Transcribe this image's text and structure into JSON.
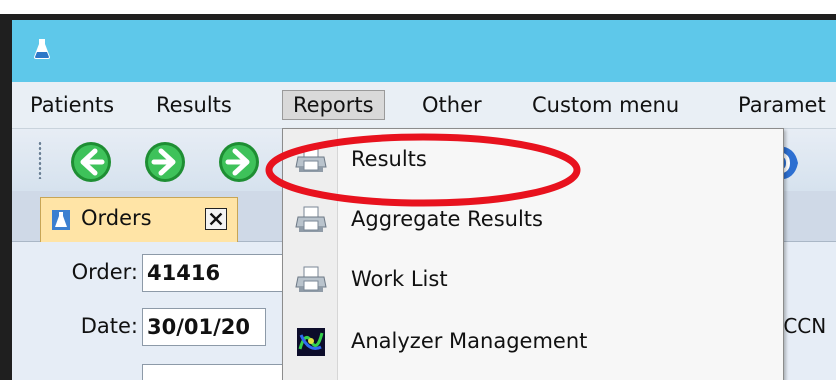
{
  "window": {
    "app_icon": "flask-icon"
  },
  "menubar": {
    "items": [
      {
        "label": "Patients"
      },
      {
        "label": "Results"
      },
      {
        "label": "Reports"
      },
      {
        "label": "Other"
      },
      {
        "label": "Custom menu"
      },
      {
        "label": "Paramet"
      }
    ],
    "active_item": "Reports"
  },
  "toolbar": {
    "buttons": [
      "arrow-left-icon",
      "arrow-right-icon",
      "arrow-right-icon"
    ]
  },
  "tabs": {
    "items": [
      {
        "label": "Orders",
        "icon": "flask-icon",
        "close_icon": "close-icon"
      }
    ]
  },
  "form": {
    "order_label": "Order:",
    "order_value": "41416",
    "date_label": "Date:",
    "date_value": "30/01/20",
    "side_text": "ACCN"
  },
  "reports_menu": {
    "items": [
      {
        "label": "Results",
        "icon": "printer-icon"
      },
      {
        "label": "Aggregate Results",
        "icon": "printer-icon"
      },
      {
        "label": "Work List",
        "icon": "printer-icon"
      },
      {
        "label": "Analyzer Management",
        "icon": "analyzer-icon"
      }
    ]
  },
  "annotation": {
    "color": "#e8121e"
  },
  "colors": {
    "titlebar": "#5ec8ea",
    "menubar": "#e9eff5",
    "tab_active": "#ffe4a6",
    "nav_green": "#2fb24a"
  }
}
